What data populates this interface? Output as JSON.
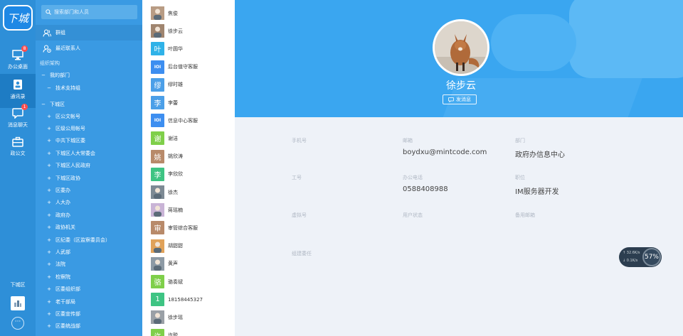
{
  "app": {
    "logo_text": "下城"
  },
  "rail": {
    "items": [
      {
        "label": "办公桌面",
        "icon": "desktop-icon",
        "badge": "8"
      },
      {
        "label": "通讯录",
        "icon": "contacts-icon",
        "badge": ""
      },
      {
        "label": "消息聊天",
        "icon": "chat-icon",
        "badge": "1"
      },
      {
        "label": "政公文",
        "icon": "briefcase-icon",
        "badge": ""
      }
    ],
    "org_label": "下城区",
    "more": "···"
  },
  "tree": {
    "search_placeholder": "搜索部门和人员",
    "quick": [
      {
        "label": "群组",
        "icon": "group-icon"
      },
      {
        "label": "最近联系人",
        "icon": "recent-contacts-icon"
      }
    ],
    "section_title": "组织架构",
    "my_dept": {
      "label": "我的部门",
      "marker": "−",
      "children": [
        {
          "label": "技术支持组",
          "marker": "−"
        }
      ]
    },
    "root": {
      "label": "下城区",
      "marker": "−"
    },
    "items": [
      "区公文帐号",
      "区级公用帐号",
      "中共下城区委",
      "下城区人大常委会",
      "下城区人民政府",
      "下城区政协",
      "区委办",
      "人大办",
      "政府办",
      "政协机关",
      "区纪委（区监察委员会）",
      "人武部",
      "法院",
      "检察院",
      "区委组织部",
      "老干部局",
      "区委宣传部",
      "区委统战部"
    ],
    "item_marker": "+"
  },
  "contacts": [
    {
      "name": "焦俊",
      "avatar": "photo",
      "color": "#b89c84",
      "char": ""
    },
    {
      "name": "徐步云",
      "avatar": "photo",
      "color": "#a0856f",
      "char": ""
    },
    {
      "name": "叶圆华",
      "avatar": "char",
      "color": "#2fb2e8",
      "char": "叶"
    },
    {
      "name": "后台值守客服",
      "avatar": "logo",
      "color": "#3d8ef0",
      "char": "IOI"
    },
    {
      "name": "缪时雄",
      "avatar": "char",
      "color": "#4b9fe8",
      "char": "缪"
    },
    {
      "name": "李蕾",
      "avatar": "char",
      "color": "#4b9fe8",
      "char": "李"
    },
    {
      "name": "信息中心客服",
      "avatar": "logo",
      "color": "#3d8ef0",
      "char": "IOI"
    },
    {
      "name": "谢洁",
      "avatar": "char",
      "color": "#7fcf4a",
      "char": "谢"
    },
    {
      "name": "姚欣涛",
      "avatar": "char",
      "color": "#b88a6a",
      "char": "姚"
    },
    {
      "name": "李欣欣",
      "avatar": "char",
      "color": "#3ec483",
      "char": "李"
    },
    {
      "name": "徐杰",
      "avatar": "photo",
      "color": "#7d8a94",
      "char": ""
    },
    {
      "name": "蒋瑶楠",
      "avatar": "photo",
      "color": "#c9b4d6",
      "char": ""
    },
    {
      "name": "审管综合客服",
      "avatar": "char",
      "color": "#b88a6a",
      "char": "审"
    },
    {
      "name": "胡甜甜",
      "avatar": "photo",
      "color": "#e0a25a",
      "char": ""
    },
    {
      "name": "黄声",
      "avatar": "photo",
      "color": "#8d9aa5",
      "char": ""
    },
    {
      "name": "骆奏斌",
      "avatar": "char",
      "color": "#7fcf4a",
      "char": "骆"
    },
    {
      "name": "18158445327",
      "avatar": "char",
      "color": "#3ec483",
      "char": "1"
    },
    {
      "name": "徐步瑶",
      "avatar": "photo",
      "color": "#9aa0a6",
      "char": ""
    },
    {
      "name": "许聪",
      "avatar": "char",
      "color": "#7fcf4a",
      "char": "许"
    }
  ],
  "profile": {
    "name": "徐步云",
    "message_button": "发消息",
    "fields": [
      {
        "label": "手机号",
        "value": ""
      },
      {
        "label": "邮箱",
        "value": "boydxu@mintcode.com"
      },
      {
        "label": "部门",
        "value": "政府办信息中心"
      },
      {
        "label": "工号",
        "value": ""
      },
      {
        "label": "办公电话",
        "value": "0588408988"
      },
      {
        "label": "职位",
        "value": "IM服务器开发"
      },
      {
        "label": "虚拟号",
        "value": ""
      },
      {
        "label": "用户状态",
        "value": ""
      },
      {
        "label": "备用邮箱",
        "value": ""
      },
      {
        "label": "组建委任",
        "value": ""
      }
    ]
  },
  "network": {
    "up": "32.6K/s",
    "down": "0.1K/s",
    "percent": "57%"
  }
}
